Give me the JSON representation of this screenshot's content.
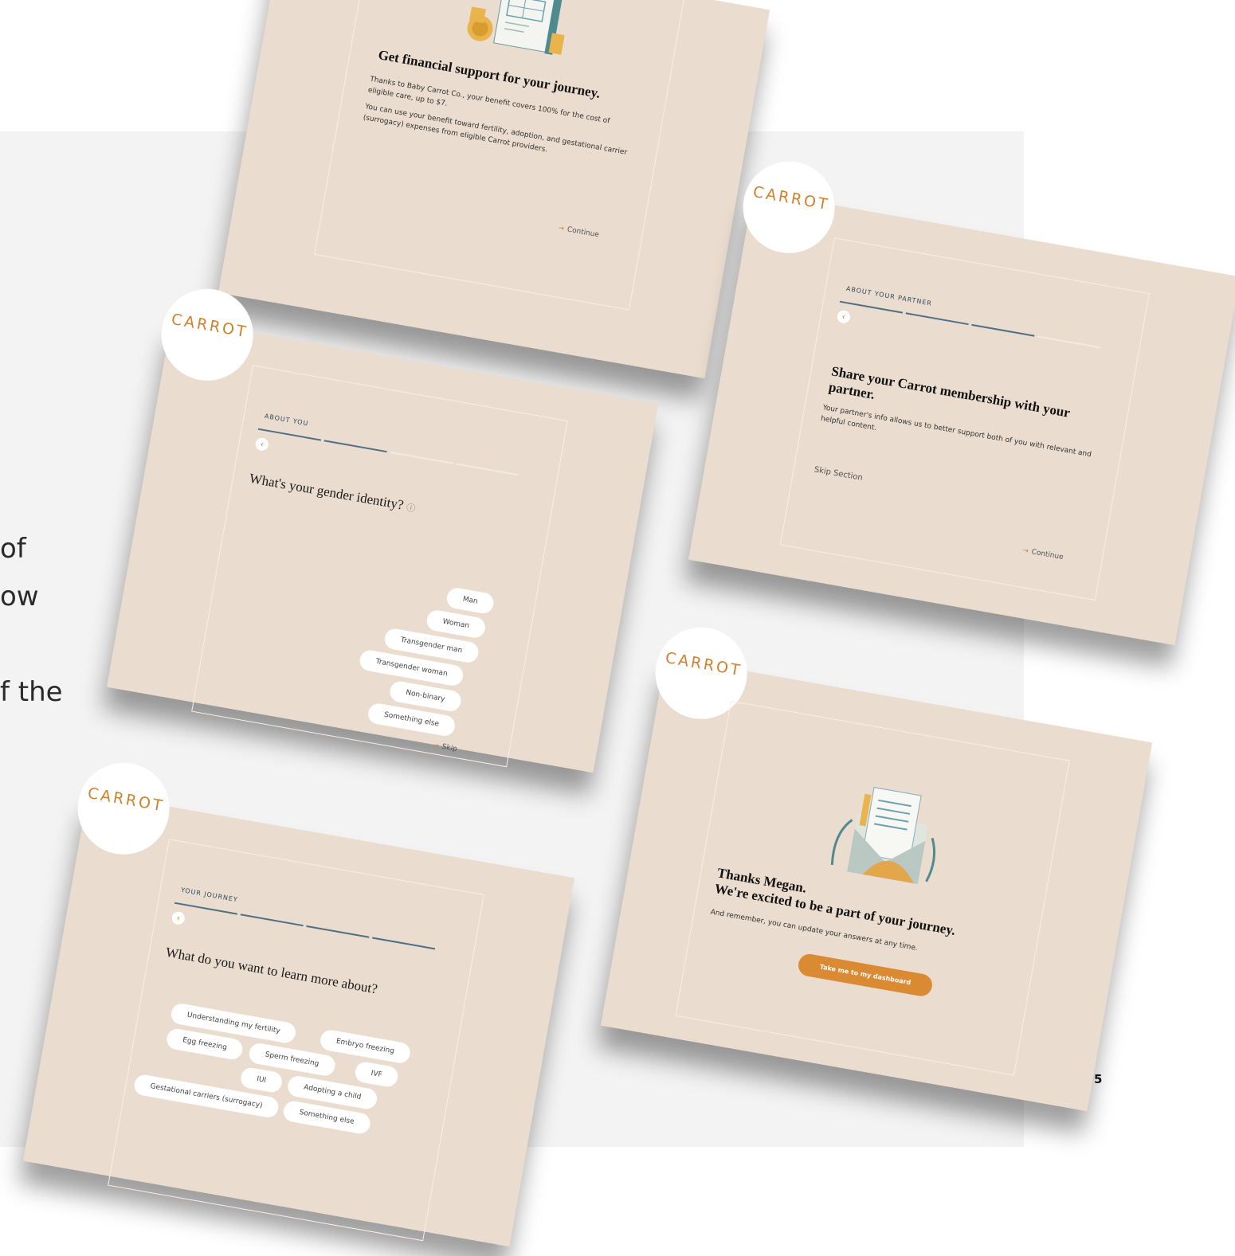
{
  "slide": {
    "line1": "of",
    "line2": "ow",
    "line3": "f the",
    "page_number": "5"
  },
  "brand": {
    "logo_text": "CARROT",
    "accent": "#d1802e",
    "card_bg": "#eadcce"
  },
  "financial": {
    "title": "Get financial support for your journey.",
    "para1": "Thanks to Baby Carrot Co., your benefit covers 100% for the cost of eligible care, up to $7.",
    "para2": "You can use your benefit toward fertility, adoption, and gestational carrier (surrogacy) expenses from eligible Carrot providers.",
    "continue_label": "Continue"
  },
  "about_you": {
    "section": "ABOUT YOU",
    "question": "What's your gender identity?",
    "options": [
      "Man",
      "Woman",
      "Transgender man",
      "Transgender woman",
      "Non-binary",
      "Something else"
    ],
    "skip_label": "Skip"
  },
  "partner": {
    "section": "ABOUT YOUR PARTNER",
    "title": "Share your Carrot membership with your partner.",
    "body": "Your partner's info allows us to better support both of you with relevant and helpful content.",
    "skip_section_label": "Skip Section",
    "continue_label": "Continue"
  },
  "journey": {
    "section": "YOUR JOURNEY",
    "question": "What do you want to learn more about?",
    "options": [
      "Understanding my fertility",
      "Embryo freezing",
      "Egg freezing",
      "Sperm freezing",
      "IVF",
      "IUI",
      "Adopting a child",
      "Gestational carriers (surrogacy)",
      "Something else"
    ]
  },
  "thanks": {
    "title_line1": "Thanks Megan.",
    "title_line2": "We're excited to be a part of your journey.",
    "body": "And remember, you can update your answers at any time.",
    "cta_label": "Take me to my dashboard"
  }
}
